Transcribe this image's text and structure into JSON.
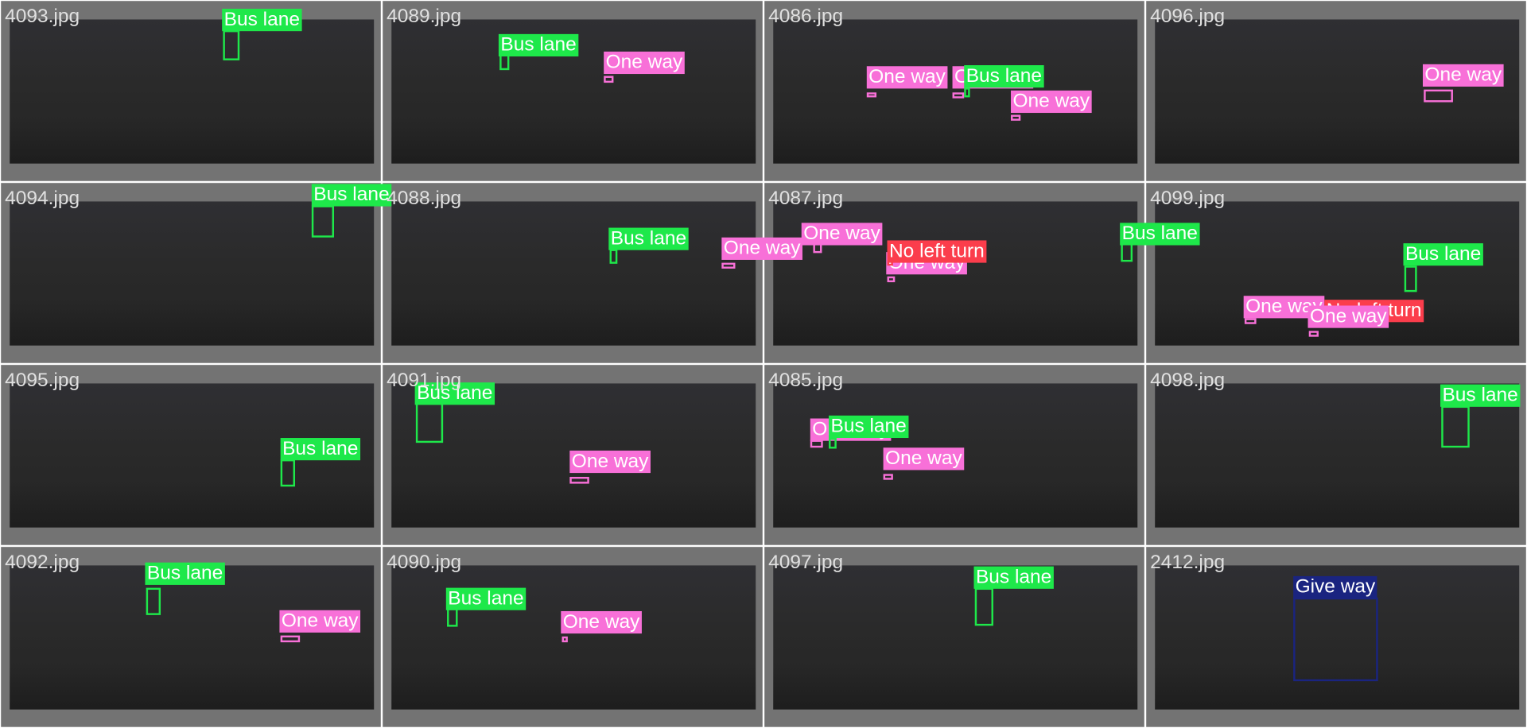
{
  "classes": {
    "Bus lane": "#1ee84a",
    "One way": "#f870d8",
    "No left turn": "#fb3d4c",
    "Give way": "#1a2480"
  },
  "tiles": [
    {
      "filename": "4093.jpg",
      "detections": [
        {
          "label": "Bus lane"
        }
      ]
    },
    {
      "filename": "4089.jpg",
      "detections": [
        {
          "label": "Bus lane"
        },
        {
          "label": "One way"
        }
      ]
    },
    {
      "filename": "4086.jpg",
      "detections": [
        {
          "label": "One way"
        },
        {
          "label": "One way"
        },
        {
          "label": "Bus lane"
        },
        {
          "label": "One way"
        }
      ]
    },
    {
      "filename": "4096.jpg",
      "detections": [
        {
          "label": "One way"
        }
      ]
    },
    {
      "filename": "4094.jpg",
      "detections": [
        {
          "label": "Bus lane"
        }
      ]
    },
    {
      "filename": "4088.jpg",
      "detections": [
        {
          "label": "Bus lane"
        },
        {
          "label": "One way"
        }
      ]
    },
    {
      "filename": "4087.jpg",
      "detections": [
        {
          "label": "One way"
        },
        {
          "label": "One way"
        },
        {
          "label": "No left turn"
        },
        {
          "label": "Bus lane"
        }
      ]
    },
    {
      "filename": "4099.jpg",
      "detections": [
        {
          "label": "Bus lane"
        },
        {
          "label": "One way"
        },
        {
          "label": "No left turn"
        },
        {
          "label": "One way"
        }
      ]
    },
    {
      "filename": "4095.jpg",
      "detections": [
        {
          "label": "Bus lane"
        }
      ]
    },
    {
      "filename": "4091.jpg",
      "detections": [
        {
          "label": "Bus lane"
        },
        {
          "label": "One way"
        }
      ]
    },
    {
      "filename": "4085.jpg",
      "detections": [
        {
          "label": "One way"
        },
        {
          "label": "Bus lane"
        },
        {
          "label": "One way"
        }
      ]
    },
    {
      "filename": "4098.jpg",
      "detections": [
        {
          "label": "Bus lane"
        }
      ]
    },
    {
      "filename": "4092.jpg",
      "detections": [
        {
          "label": "Bus lane"
        },
        {
          "label": "One way"
        }
      ]
    },
    {
      "filename": "4090.jpg",
      "detections": [
        {
          "label": "Bus lane"
        },
        {
          "label": "One way"
        }
      ]
    },
    {
      "filename": "4097.jpg",
      "detections": [
        {
          "label": "Bus lane"
        }
      ]
    },
    {
      "filename": "2412.jpg",
      "detections": [
        {
          "label": "Give way"
        }
      ]
    }
  ]
}
